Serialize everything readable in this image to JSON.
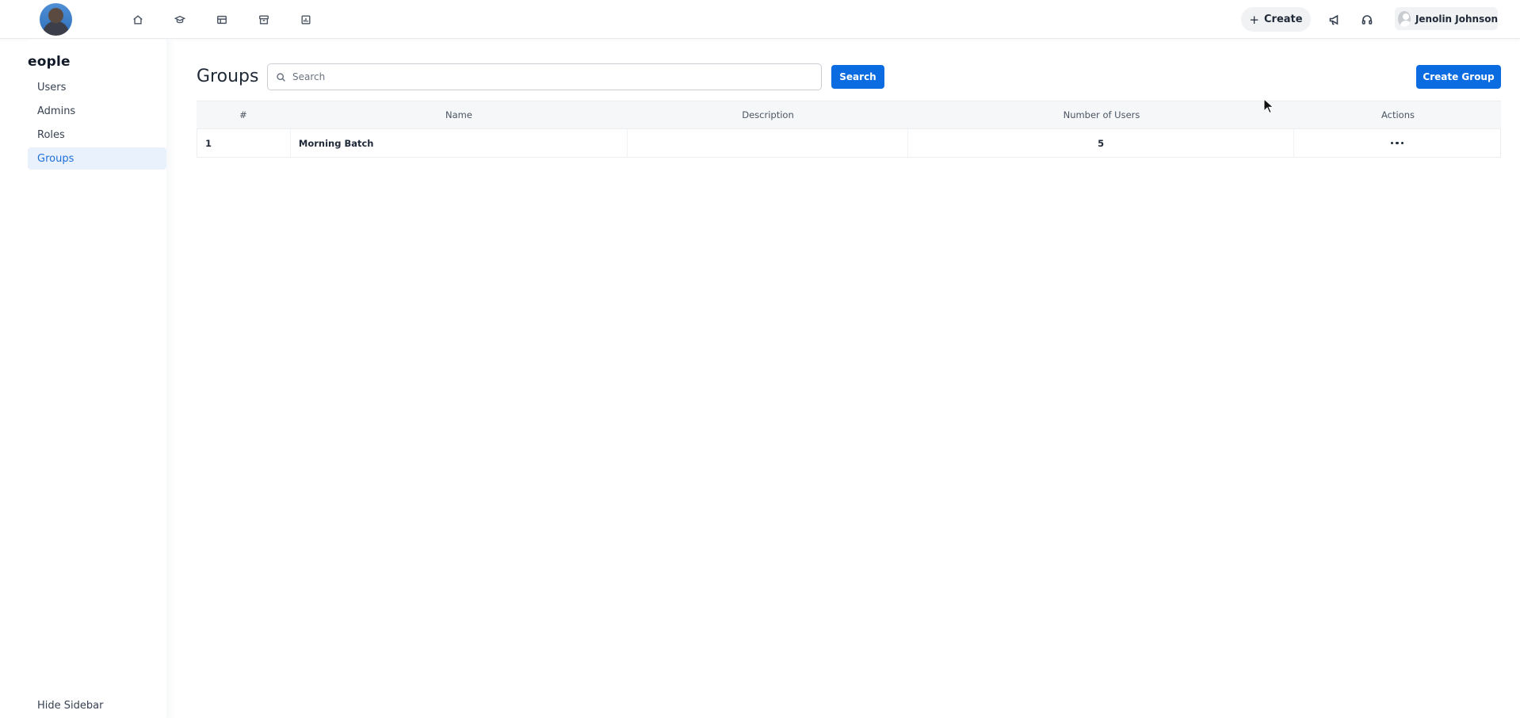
{
  "topbar": {
    "nav_icons": [
      "home-icon",
      "graduation-cap-icon",
      "table-icon",
      "archive-icon",
      "chart-icon"
    ],
    "create_label": "Create",
    "user_name": "Jenolin Johnson"
  },
  "sidebar": {
    "title": "eople",
    "items": [
      {
        "label": "Users",
        "active": false
      },
      {
        "label": "Admins",
        "active": false
      },
      {
        "label": "Roles",
        "active": false
      },
      {
        "label": "Groups",
        "active": true
      }
    ],
    "hide_label": "Hide Sidebar"
  },
  "main": {
    "title": "Groups",
    "search_placeholder": "Search",
    "search_value": "",
    "search_button": "Search",
    "create_button": "Create Group",
    "table": {
      "headers": [
        "#",
        "Name",
        "Description",
        "Number of Users",
        "Actions"
      ],
      "rows": [
        {
          "index": "1",
          "name": "Morning Batch",
          "description": "",
          "users": "5"
        }
      ]
    }
  },
  "colors": {
    "accent": "#0b6be0",
    "active_bg": "#e9f1fd",
    "active_text": "#1f6fd9"
  }
}
